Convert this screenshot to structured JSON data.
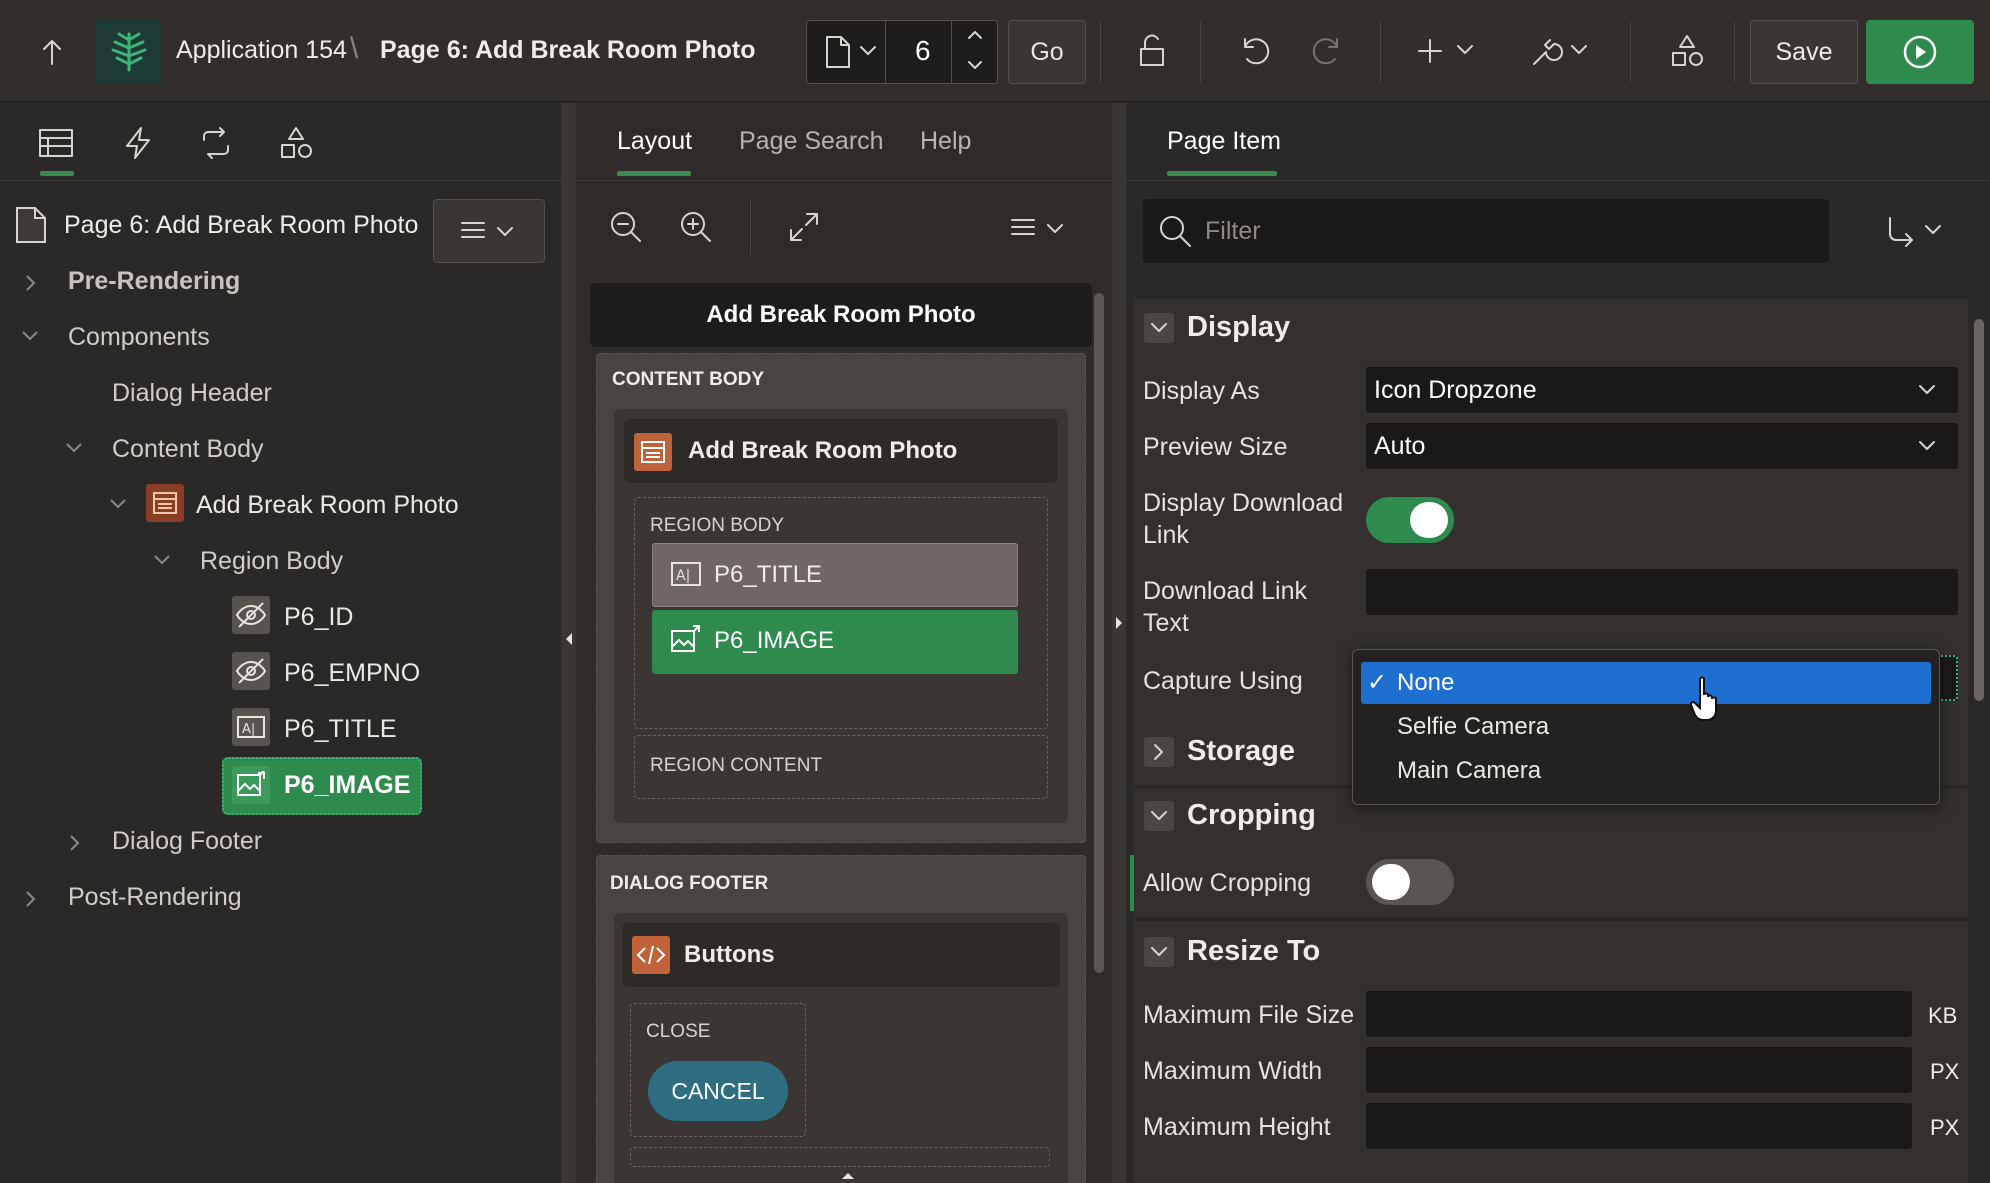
{
  "header": {
    "app_name": "Application 154",
    "page_title": "Page 6: Add Break Room Photo",
    "page_number": "6",
    "go_label": "Go",
    "save_label": "Save"
  },
  "left": {
    "page_node": "Page 6: Add Break Room Photo",
    "pre_rendering": "Pre-Rendering",
    "components": "Components",
    "dialog_header": "Dialog Header",
    "content_body": "Content Body",
    "region": "Add Break Room Photo",
    "region_body": "Region Body",
    "items": [
      "P6_ID",
      "P6_EMPNO",
      "P6_TITLE",
      "P6_IMAGE"
    ],
    "dialog_footer": "Dialog Footer",
    "post_rendering": "Post-Rendering"
  },
  "middle": {
    "tabs": [
      "Layout",
      "Page Search",
      "Help"
    ],
    "dialog_title": "Add Break Room Photo",
    "content_body_label": "CONTENT BODY",
    "region_name": "Add Break Room Photo",
    "region_body_label": "REGION BODY",
    "item_title": "P6_TITLE",
    "item_image": "P6_IMAGE",
    "region_content_label": "REGION CONTENT",
    "dialog_footer_label": "DIALOG FOOTER",
    "buttons_region": "Buttons",
    "close_label": "CLOSE",
    "cancel_label": "CANCEL"
  },
  "right": {
    "tab": "Page Item",
    "filter_placeholder": "Filter",
    "display_section": "Display",
    "display_as_label": "Display As",
    "display_as_value": "Icon Dropzone",
    "preview_size_label": "Preview Size",
    "preview_size_value": "Auto",
    "download_link_label": "Display Download Link",
    "download_link_text_label": "Download Link Text",
    "capture_using_label": "Capture Using",
    "capture_options": [
      "None",
      "Selfie Camera",
      "Main Camera"
    ],
    "storage_section": "Storage",
    "cropping_section": "Cropping",
    "allow_cropping_label": "Allow Cropping",
    "resize_section": "Resize To",
    "max_file_size_label": "Maximum File Size",
    "max_file_size_unit": "KB",
    "max_width_label": "Maximum Width",
    "max_width_unit": "PX",
    "max_height_label": "Maximum Height",
    "max_height_unit": "PX"
  },
  "colors": {
    "accent_green": "#2f8a4e",
    "selection_blue": "#1f6fd1",
    "cancel_teal": "#2e6e80",
    "region_orange": "#c0623a"
  }
}
